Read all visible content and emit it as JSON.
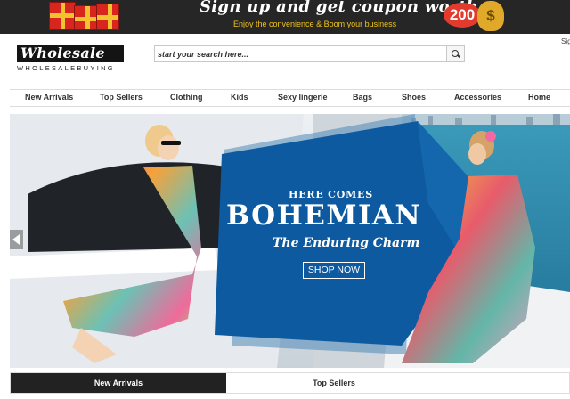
{
  "promo": {
    "headline": "Sign up and get coupon worth",
    "subline": "Enjoy the convenience & Boom your business",
    "amount": "200",
    "currency_symbol": "$"
  },
  "header": {
    "logo_text": "Wholesale",
    "logo_tagline": "WHOLESALEBUYING",
    "search_placeholder": "start your search here...",
    "signin_text": "Sig"
  },
  "nav": {
    "items": [
      "New Arrivals",
      "Top Sellers",
      "Clothing",
      "Kids",
      "Sexy lingerie",
      "Bags",
      "Shoes",
      "Accessories",
      "Home"
    ]
  },
  "hero": {
    "line1": "HERE COMES",
    "line2": "BOHEMIAN",
    "line3": "The Enduring Charm",
    "button": "SHOP NOW",
    "panel_color": "#0d5aa0",
    "sea_color": "#2f8fb0"
  },
  "tabs": {
    "items": [
      "New Arrivals",
      "Top Sellers"
    ],
    "active_index": 0
  },
  "icons": {
    "search": "magnifier-icon",
    "prev": "chevron-left-icon",
    "gift": "gift-box-icon",
    "money_bag": "money-bag-icon"
  }
}
